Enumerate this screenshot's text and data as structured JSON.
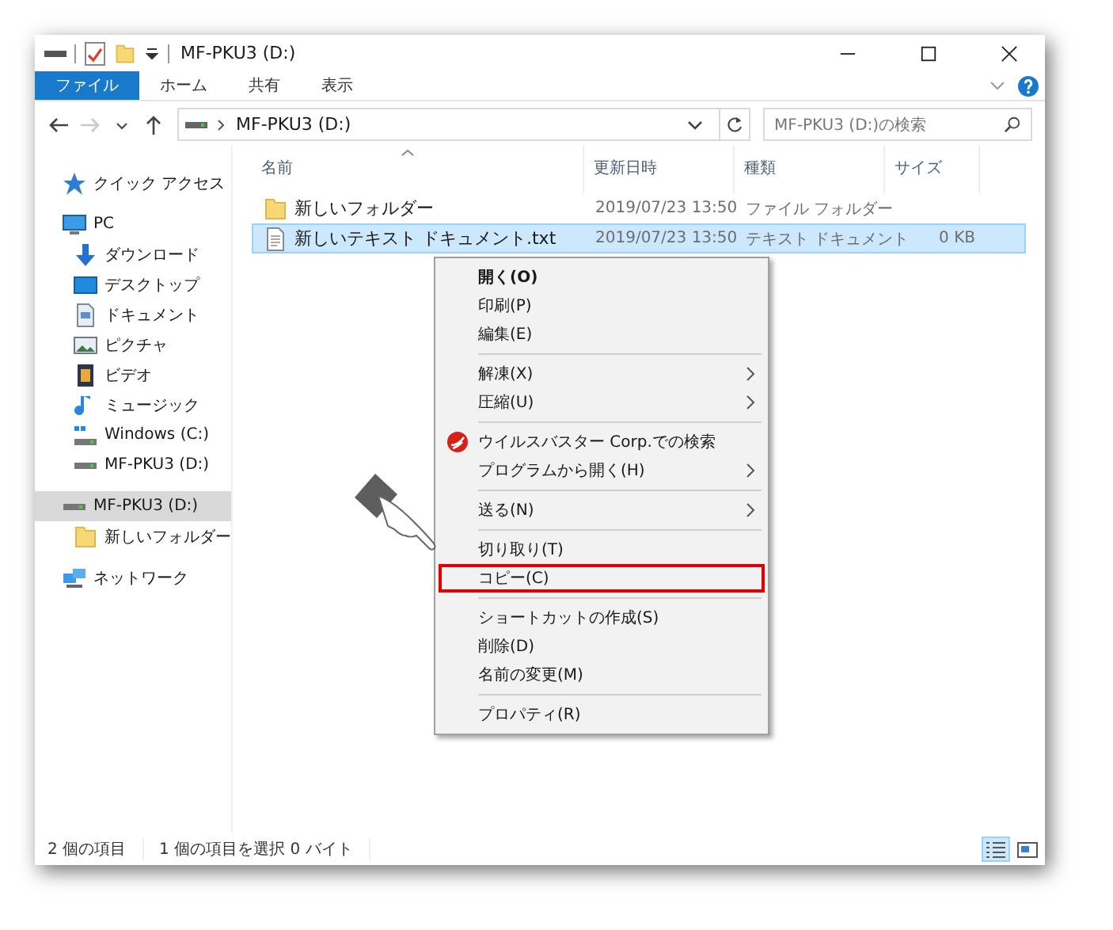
{
  "window": {
    "title": "MF-PKU3 (D:)"
  },
  "ribbon_tabs": [
    {
      "label": "ファイル",
      "selected": true
    },
    {
      "label": "ホーム",
      "selected": false
    },
    {
      "label": "共有",
      "selected": false
    },
    {
      "label": "表示",
      "selected": false
    }
  ],
  "nav_buttons": [
    {
      "kind": "back",
      "disabled": false
    },
    {
      "kind": "forward",
      "disabled": true
    },
    {
      "kind": "recent",
      "disabled": false
    },
    {
      "kind": "up",
      "disabled": false
    }
  ],
  "address": {
    "segments": [
      "MF-PKU3 (D:)"
    ]
  },
  "search": {
    "placeholder": "MF-PKU3 (D:)の検索"
  },
  "sidebar": {
    "items": [
      {
        "label": "クイック アクセス",
        "kind": "star",
        "selected": false
      },
      {
        "label": "PC",
        "kind": "pc",
        "selected": false,
        "children": [
          {
            "label": "ダウンロード",
            "kind": "download",
            "selected": false
          },
          {
            "label": "デスクトップ",
            "kind": "desktop",
            "selected": false
          },
          {
            "label": "ドキュメント",
            "kind": "document",
            "selected": false
          },
          {
            "label": "ピクチャ",
            "kind": "picture",
            "selected": false
          },
          {
            "label": "ビデオ",
            "kind": "video",
            "selected": false
          },
          {
            "label": "ミュージック",
            "kind": "music",
            "selected": false
          },
          {
            "label": "Windows (C:)",
            "kind": "windows-drive",
            "selected": false
          },
          {
            "label": "MF-PKU3 (D:)",
            "kind": "drive",
            "selected": false
          }
        ]
      },
      {
        "label": "MF-PKU3 (D:)",
        "kind": "drive",
        "selected": true,
        "children": [
          {
            "label": "新しいフォルダー",
            "kind": "folder",
            "selected": false
          }
        ]
      },
      {
        "label": "ネットワーク",
        "kind": "network",
        "selected": false
      }
    ]
  },
  "table": {
    "columns": [
      "名前",
      "更新日時",
      "種類",
      "サイズ"
    ],
    "rows": [
      {
        "kind": "folder",
        "cells": [
          "新しいフォルダー",
          "2019/07/23 13:50",
          "ファイル フォルダー",
          ""
        ],
        "selected": false
      },
      {
        "kind": "text-file",
        "cells": [
          "新しいテキスト ドキュメント.txt",
          "2019/07/23 13:50",
          "テキスト ドキュメント",
          "0 KB"
        ],
        "selected": true
      }
    ]
  },
  "context_menu": [
    {
      "kind": "item",
      "label": "開く(O)",
      "default": true,
      "submenu": false,
      "has_icon": false,
      "highlighted": false
    },
    {
      "kind": "item",
      "label": "印刷(P)",
      "default": false,
      "submenu": false,
      "has_icon": false,
      "highlighted": false
    },
    {
      "kind": "item",
      "label": "編集(E)",
      "default": false,
      "submenu": false,
      "has_icon": false,
      "highlighted": false
    },
    {
      "kind": "separator"
    },
    {
      "kind": "item",
      "label": "解凍(X)",
      "default": false,
      "submenu": true,
      "has_icon": false,
      "highlighted": false
    },
    {
      "kind": "item",
      "label": "圧縮(U)",
      "default": false,
      "submenu": true,
      "has_icon": false,
      "highlighted": false
    },
    {
      "kind": "separator"
    },
    {
      "kind": "item",
      "label": "ウイルスバスター Corp.での検索",
      "default": false,
      "submenu": false,
      "has_icon": true,
      "highlighted": false
    },
    {
      "kind": "item",
      "label": "プログラムから開く(H)",
      "default": false,
      "submenu": true,
      "has_icon": false,
      "highlighted": false
    },
    {
      "kind": "separator"
    },
    {
      "kind": "item",
      "label": "送る(N)",
      "default": false,
      "submenu": true,
      "has_icon": false,
      "highlighted": false
    },
    {
      "kind": "separator"
    },
    {
      "kind": "item",
      "label": "切り取り(T)",
      "default": false,
      "submenu": false,
      "has_icon": false,
      "highlighted": false
    },
    {
      "kind": "item",
      "label": "コピー(C)",
      "default": false,
      "submenu": false,
      "has_icon": false,
      "highlighted": true
    },
    {
      "kind": "separator"
    },
    {
      "kind": "item",
      "label": "ショートカットの作成(S)",
      "default": false,
      "submenu": false,
      "has_icon": false,
      "highlighted": false
    },
    {
      "kind": "item",
      "label": "削除(D)",
      "default": false,
      "submenu": false,
      "has_icon": false,
      "highlighted": false
    },
    {
      "kind": "item",
      "label": "名前の変更(M)",
      "default": false,
      "submenu": false,
      "has_icon": false,
      "highlighted": false
    },
    {
      "kind": "separator"
    },
    {
      "kind": "item",
      "label": "プロパティ(R)",
      "default": false,
      "submenu": false,
      "has_icon": false,
      "highlighted": false
    }
  ],
  "status_bar": {
    "texts": [
      "2 個の項目",
      "1 個の項目を選択  0 バイト"
    ],
    "views": [
      {
        "kind": "details",
        "selected": true
      },
      {
        "kind": "large-icons",
        "selected": false
      }
    ]
  }
}
